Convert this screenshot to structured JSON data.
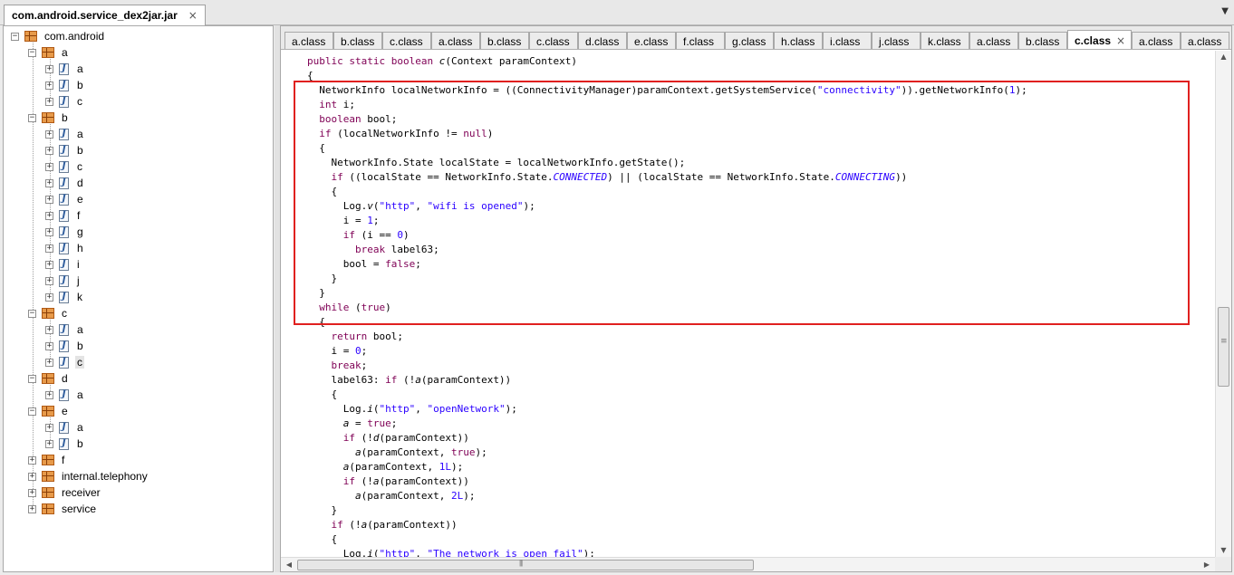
{
  "file_tab": {
    "label": "com.android.service_dex2jar.jar",
    "close": "×"
  },
  "window_menu": "▼",
  "tree": {
    "rows": [
      {
        "kind": "pkg",
        "label": "com.android",
        "expander": "−"
      },
      {
        "kind": "pkg",
        "label": "a",
        "expander": "−"
      },
      {
        "kind": "file",
        "label": "a",
        "expander": "+"
      },
      {
        "kind": "file",
        "label": "b",
        "expander": "+"
      },
      {
        "kind": "file",
        "label": "c",
        "expander": "+"
      },
      {
        "kind": "pkg",
        "label": "b",
        "expander": "−"
      },
      {
        "kind": "file",
        "label": "a",
        "expander": "+"
      },
      {
        "kind": "file",
        "label": "b",
        "expander": "+"
      },
      {
        "kind": "file",
        "label": "c",
        "expander": "+"
      },
      {
        "kind": "file",
        "label": "d",
        "expander": "+"
      },
      {
        "kind": "file",
        "label": "e",
        "expander": "+"
      },
      {
        "kind": "file",
        "label": "f",
        "expander": "+"
      },
      {
        "kind": "file",
        "label": "g",
        "expander": "+"
      },
      {
        "kind": "file",
        "label": "h",
        "expander": "+"
      },
      {
        "kind": "file",
        "label": "i",
        "expander": "+"
      },
      {
        "kind": "file",
        "label": "j",
        "expander": "+"
      },
      {
        "kind": "file",
        "label": "k",
        "expander": "+"
      },
      {
        "kind": "pkg",
        "label": "c",
        "expander": "−"
      },
      {
        "kind": "file",
        "label": "a",
        "expander": "+"
      },
      {
        "kind": "file",
        "label": "b",
        "expander": "+"
      },
      {
        "kind": "file",
        "label": "c",
        "expander": "+",
        "selected": true
      },
      {
        "kind": "pkg",
        "label": "d",
        "expander": "−"
      },
      {
        "kind": "file",
        "label": "a",
        "expander": "+"
      },
      {
        "kind": "pkg",
        "label": "e",
        "expander": "−"
      },
      {
        "kind": "file",
        "label": "a",
        "expander": "+"
      },
      {
        "kind": "file",
        "label": "b",
        "expander": "+"
      },
      {
        "kind": "pkg",
        "label": "f",
        "expander": "+"
      },
      {
        "kind": "pkg",
        "label": "internal.telephony",
        "expander": "+"
      },
      {
        "kind": "pkg",
        "label": "receiver",
        "expander": "+"
      },
      {
        "kind": "pkg",
        "label": "service",
        "expander": "+"
      }
    ]
  },
  "class_tabs": {
    "labels": [
      "a.class",
      "b.class",
      "c.class",
      "a.class",
      "b.class",
      "c.class",
      "d.class",
      "e.class",
      "f.class",
      "g.class",
      "h.class",
      "i.class",
      "j.class",
      "k.class",
      "a.class",
      "b.class",
      "c.class",
      "a.class",
      "a.class"
    ],
    "active_index": 16,
    "close": "×",
    "scroll_icon": "▼"
  },
  "code": {
    "lines": [
      [
        [
          "kw",
          "public static boolean "
        ],
        [
          "ital",
          "c"
        ],
        [
          "",
          "(Context paramContext)"
        ]
      ],
      [
        [
          "",
          "{"
        ]
      ],
      [
        [
          "",
          "  NetworkInfo localNetworkInfo = ((ConnectivityManager)paramContext.getSystemService("
        ],
        [
          "str",
          "\"connectivity\""
        ],
        [
          "",
          "))."
        ],
        [
          "",
          "getNetworkInfo("
        ],
        [
          "num",
          "1"
        ],
        [
          "",
          ");"
        ]
      ],
      [
        [
          "",
          "  "
        ],
        [
          "kw",
          "int"
        ],
        [
          "",
          " i;"
        ]
      ],
      [
        [
          "",
          "  "
        ],
        [
          "kw",
          "boolean"
        ],
        [
          "",
          " bool;"
        ]
      ],
      [
        [
          "",
          "  "
        ],
        [
          "kw",
          "if"
        ],
        [
          "",
          " (localNetworkInfo != "
        ],
        [
          "kw",
          "null"
        ],
        [
          "",
          ")"
        ]
      ],
      [
        [
          "",
          "  {"
        ]
      ],
      [
        [
          "",
          "    NetworkInfo.State localState = localNetworkInfo.getState();"
        ]
      ],
      [
        [
          "",
          "    "
        ],
        [
          "kw",
          "if"
        ],
        [
          "",
          " ((localState == NetworkInfo.State."
        ],
        [
          "itblue",
          "CONNECTED"
        ],
        [
          "",
          ") || (localState == NetworkInfo.State."
        ],
        [
          "itblue",
          "CONNECTING"
        ],
        [
          "",
          "))"
        ]
      ],
      [
        [
          "",
          "    {"
        ]
      ],
      [
        [
          "",
          "      Log."
        ],
        [
          "ital",
          "v"
        ],
        [
          "",
          "("
        ],
        [
          "str",
          "\"http\""
        ],
        [
          "",
          ", "
        ],
        [
          "str",
          "\"wifi is opened\""
        ],
        [
          "",
          ");"
        ]
      ],
      [
        [
          "",
          "      i = "
        ],
        [
          "num",
          "1"
        ],
        [
          "",
          ";"
        ]
      ],
      [
        [
          "",
          "      "
        ],
        [
          "kw",
          "if"
        ],
        [
          "",
          " (i == "
        ],
        [
          "num",
          "0"
        ],
        [
          "",
          ")"
        ]
      ],
      [
        [
          "",
          "        "
        ],
        [
          "kw",
          "break"
        ],
        [
          "",
          " label63;"
        ]
      ],
      [
        [
          "",
          "      bool = "
        ],
        [
          "kw",
          "false"
        ],
        [
          "",
          ";"
        ]
      ],
      [
        [
          "",
          "    }"
        ]
      ],
      [
        [
          "",
          "  }"
        ]
      ],
      [
        [
          "",
          "  "
        ],
        [
          "kw",
          "while"
        ],
        [
          "",
          " ("
        ],
        [
          "kw",
          "true"
        ],
        [
          "",
          ")"
        ]
      ],
      [
        [
          "",
          "  {"
        ]
      ],
      [
        [
          "",
          "    "
        ],
        [
          "kw",
          "return"
        ],
        [
          "",
          " bool;"
        ]
      ],
      [
        [
          "",
          "    i = "
        ],
        [
          "num",
          "0"
        ],
        [
          "",
          ";"
        ]
      ],
      [
        [
          "",
          "    "
        ],
        [
          "kw",
          "break"
        ],
        [
          "",
          ";"
        ]
      ],
      [
        [
          "",
          "    label63: "
        ],
        [
          "kw",
          "if"
        ],
        [
          "",
          " (!"
        ],
        [
          "ital",
          "a"
        ],
        [
          "",
          "(paramContext))"
        ]
      ],
      [
        [
          "",
          "    {"
        ]
      ],
      [
        [
          "",
          "      Log."
        ],
        [
          "ital",
          "i"
        ],
        [
          "",
          "("
        ],
        [
          "str",
          "\"http\""
        ],
        [
          "",
          ", "
        ],
        [
          "str",
          "\"openNetwork\""
        ],
        [
          "",
          ");"
        ]
      ],
      [
        [
          "",
          "      "
        ],
        [
          "ital",
          "a"
        ],
        [
          "",
          " = "
        ],
        [
          "kw",
          "true"
        ],
        [
          "",
          ";"
        ]
      ],
      [
        [
          "",
          "      "
        ],
        [
          "kw",
          "if"
        ],
        [
          "",
          " (!"
        ],
        [
          "ital",
          "d"
        ],
        [
          "",
          "(paramContext))"
        ]
      ],
      [
        [
          "",
          "        "
        ],
        [
          "ital",
          "a"
        ],
        [
          "",
          "(paramContext, "
        ],
        [
          "kw",
          "true"
        ],
        [
          "",
          ");"
        ]
      ],
      [
        [
          "",
          "      "
        ],
        [
          "ital",
          "a"
        ],
        [
          "",
          "(paramContext, "
        ],
        [
          "num",
          "1L"
        ],
        [
          "",
          ");"
        ]
      ],
      [
        [
          "",
          "      "
        ],
        [
          "kw",
          "if"
        ],
        [
          "",
          " (!"
        ],
        [
          "ital",
          "a"
        ],
        [
          "",
          "(paramContext))"
        ]
      ],
      [
        [
          "",
          "        "
        ],
        [
          "ital",
          "a"
        ],
        [
          "",
          "(paramContext, "
        ],
        [
          "num",
          "2L"
        ],
        [
          "",
          ");"
        ]
      ],
      [
        [
          "",
          "    }"
        ]
      ],
      [
        [
          "",
          "    "
        ],
        [
          "kw",
          "if"
        ],
        [
          "",
          " (!"
        ],
        [
          "ital",
          "a"
        ],
        [
          "",
          "(paramContext))"
        ]
      ],
      [
        [
          "",
          "    {"
        ]
      ],
      [
        [
          "",
          "      Log."
        ],
        [
          "ital",
          "i"
        ],
        [
          "",
          "("
        ],
        [
          "str",
          "\"http\""
        ],
        [
          "",
          ", "
        ],
        [
          "str",
          "\"The network is open fail\""
        ],
        [
          "",
          ");"
        ]
      ]
    ]
  },
  "scroll": {
    "up": "▲",
    "down": "▼",
    "left": "◀",
    "right": "▶"
  }
}
